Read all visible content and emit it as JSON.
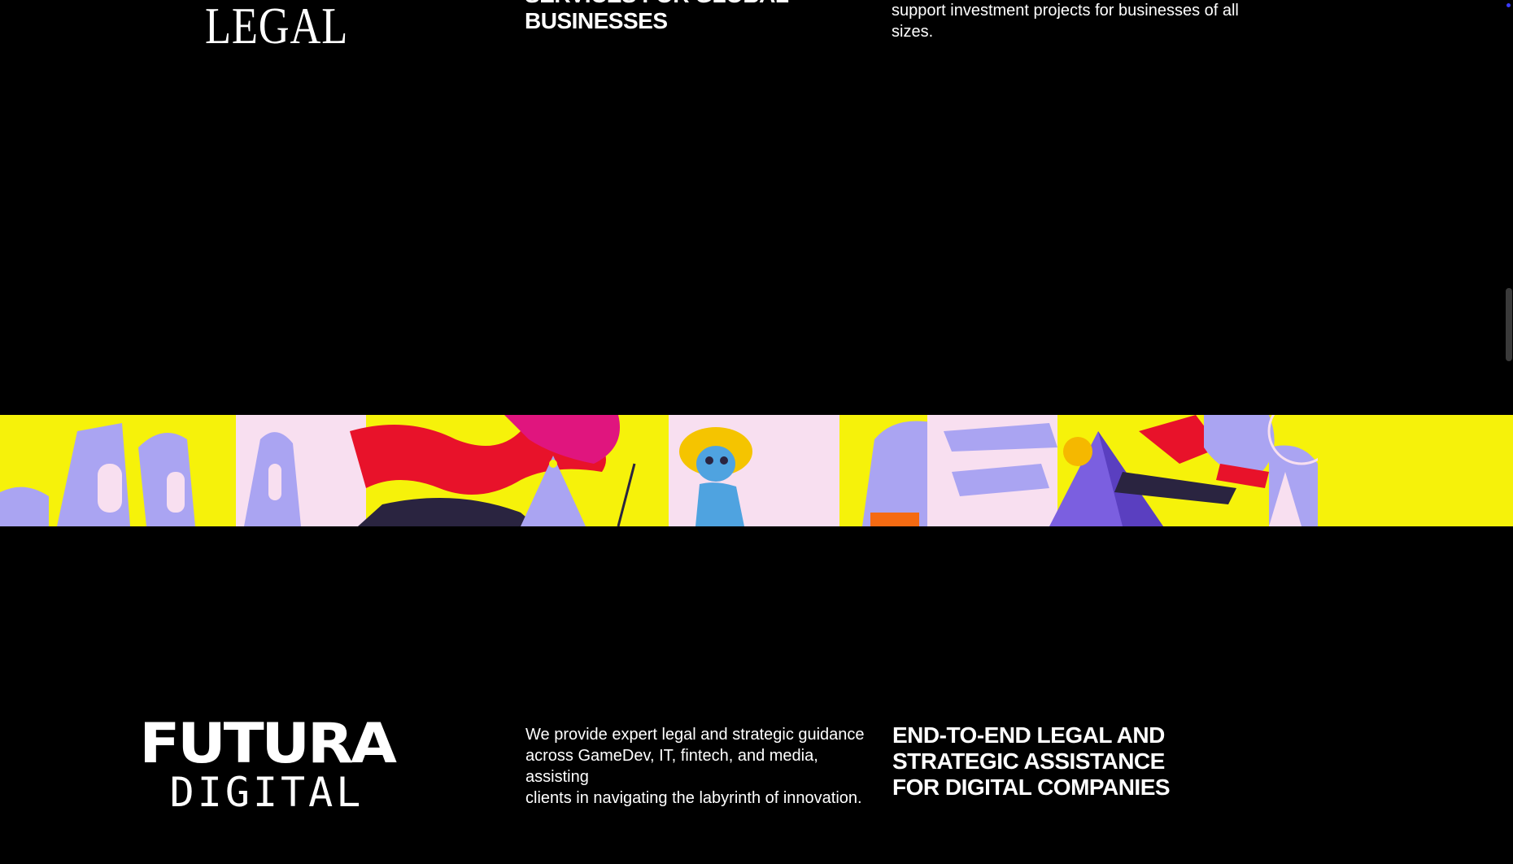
{
  "top_section": {
    "logo_text": "LEGAL",
    "heading_lines": [
      "SERVICES FOR GLOBAL",
      "BUSINESSES"
    ],
    "description_lines": [
      "support investment projects for businesses of all",
      "sizes."
    ]
  },
  "banner": {
    "colors": {
      "yellow": "#f6f20a",
      "lavender": "#aaa4f2",
      "pink": "#f8dff0",
      "red": "#e8122a",
      "magenta": "#e0157e",
      "navy": "#2a2440",
      "blue": "#4fa3e0",
      "purple": "#7b5fe0",
      "orange": "#f56a12"
    }
  },
  "bottom_section": {
    "logo": {
      "line1": "FUTURA",
      "line2": "DIGITAL"
    },
    "description_lines": [
      "We provide expert legal and strategic guidance",
      "across GameDev, IT, fintech, and media, assisting",
      "clients in navigating the labyrinth of innovation."
    ],
    "heading_lines": [
      "END-TO-END LEGAL AND",
      "STRATEGIC ASSISTANCE",
      "FOR DIGITAL COMPANIES"
    ]
  },
  "colors": {
    "background": "#000000",
    "text": "#ffffff",
    "scrollbar": "#3a3a3a",
    "corner_dot": "#3b3bff"
  }
}
